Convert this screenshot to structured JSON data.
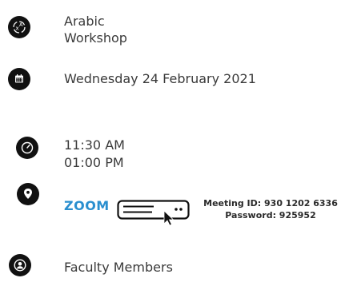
{
  "event": {
    "title_line1": "Arabic",
    "title_line2": "Workshop",
    "date": "Wednesday 24 February 2021",
    "start_time": "11:30 AM",
    "end_time": "01:00 PM",
    "platform": "ZOOM",
    "meeting_id": "Meeting ID: 930 1202 6336",
    "password": "Password: 925952",
    "audience": "Faculty Members"
  },
  "icons": {
    "title": "translate-icon",
    "date": "calendar-icon",
    "time": "clock-icon",
    "location": "map-pin-icon",
    "audience": "person-icon",
    "platform": "monitor-click-icon"
  },
  "colors": {
    "icon_bg": "#111111",
    "text": "#3a3a3a",
    "link": "#2a8fcf"
  }
}
